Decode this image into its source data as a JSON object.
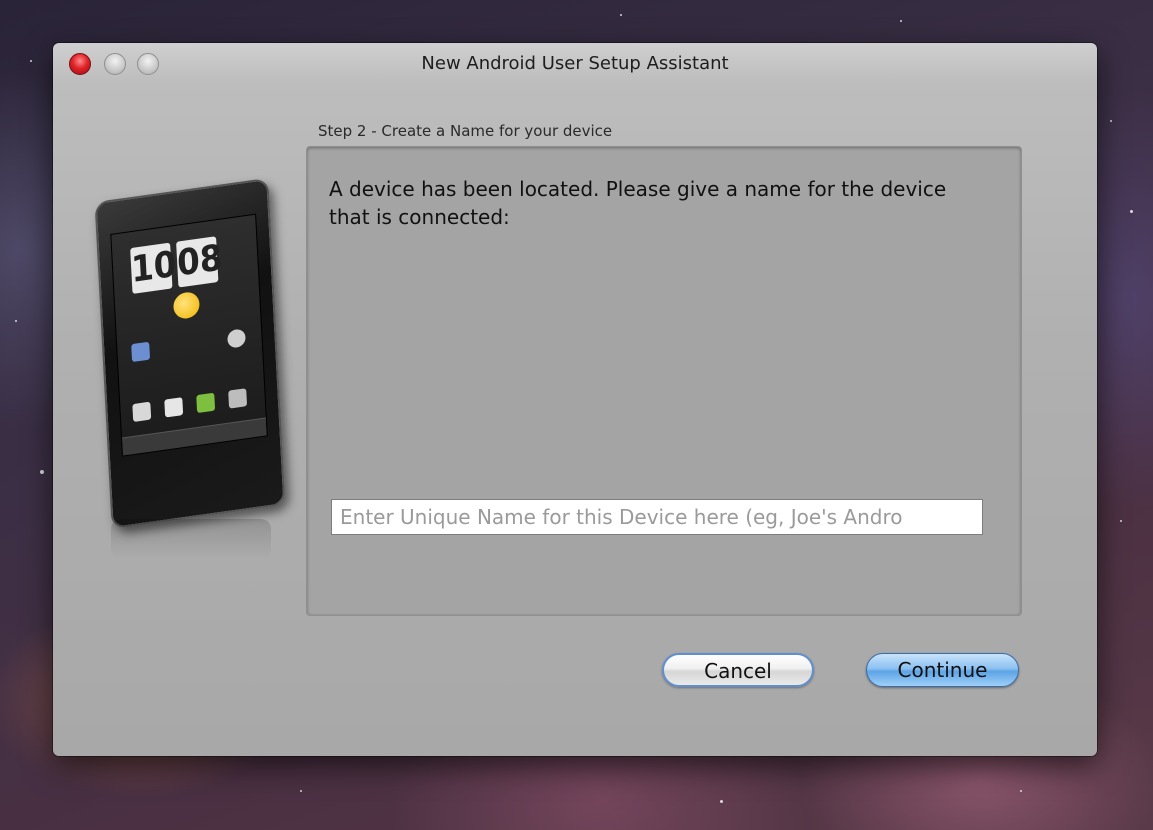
{
  "window": {
    "title": "New Android User Setup Assistant"
  },
  "step": {
    "label": "Step 2 - Create a Name for your device"
  },
  "panel": {
    "message": "A device has been located.  Please give a name for the device that is connected:",
    "name_field": {
      "value": "",
      "placeholder": "Enter Unique Name for this Device here (eg, Joe's Andro"
    }
  },
  "buttons": {
    "cancel": "Cancel",
    "continue": "Continue"
  },
  "phone": {
    "clock_hour": "10",
    "clock_minute": "08"
  },
  "colors": {
    "close_button": "#e0242a",
    "continue_button": "#5da4e6",
    "panel_background": "#a4a4a4"
  }
}
